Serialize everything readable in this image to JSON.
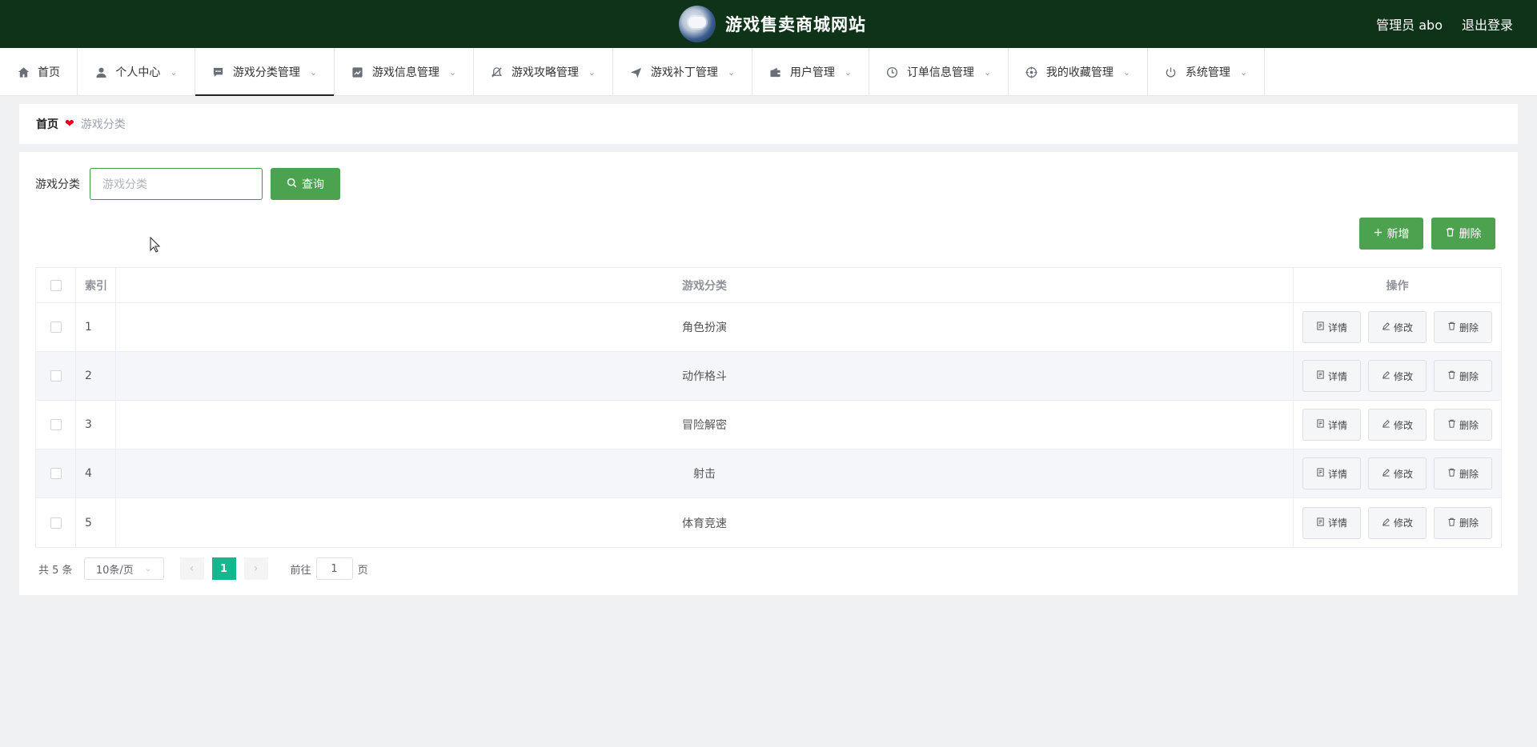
{
  "header": {
    "title": "游戏售卖商城网站",
    "user_label": "管理员 abo",
    "logout_label": "退出登录"
  },
  "nav": {
    "items": [
      {
        "label": "首页",
        "icon": "home-icon",
        "dropdown": false
      },
      {
        "label": "个人中心",
        "icon": "user-icon",
        "dropdown": true
      },
      {
        "label": "游戏分类管理",
        "icon": "chat-icon",
        "dropdown": true,
        "active": true
      },
      {
        "label": "游戏信息管理",
        "icon": "chart-icon",
        "dropdown": true
      },
      {
        "label": "游戏攻略管理",
        "icon": "bell-off-icon",
        "dropdown": true
      },
      {
        "label": "游戏补丁管理",
        "icon": "paper-plane-icon",
        "dropdown": true
      },
      {
        "label": "用户管理",
        "icon": "wallet-icon",
        "dropdown": true
      },
      {
        "label": "订单信息管理",
        "icon": "clock-icon",
        "dropdown": true
      },
      {
        "label": "我的收藏管理",
        "icon": "target-icon",
        "dropdown": true
      },
      {
        "label": "系统管理",
        "icon": "power-icon",
        "dropdown": true
      }
    ]
  },
  "breadcrumb": {
    "home": "首页",
    "current": "游戏分类"
  },
  "search": {
    "label": "游戏分类",
    "placeholder": "游戏分类",
    "value": "",
    "button_label": "查询"
  },
  "actions": {
    "add_label": "新增",
    "delete_label": "删除"
  },
  "table": {
    "headers": {
      "index": "索引",
      "name": "游戏分类",
      "ops": "操作"
    },
    "rows": [
      {
        "index": "1",
        "name": "角色扮演"
      },
      {
        "index": "2",
        "name": "动作格斗"
      },
      {
        "index": "3",
        "name": "冒险解密"
      },
      {
        "index": "4",
        "name": "射击"
      },
      {
        "index": "5",
        "name": "体育竞速"
      }
    ],
    "row_actions": {
      "detail": "详情",
      "edit": "修改",
      "delete": "删除"
    }
  },
  "pagination": {
    "total_text": "共 5 条",
    "page_size": "10条/页",
    "current_page": "1",
    "goto_prefix": "前往",
    "goto_value": "1",
    "goto_suffix": "页"
  },
  "colors": {
    "header_bg": "#0f3318",
    "primary_green": "#4ca24e",
    "page_active": "#14b88f",
    "breadcrumb_heart": "#e0001b"
  }
}
